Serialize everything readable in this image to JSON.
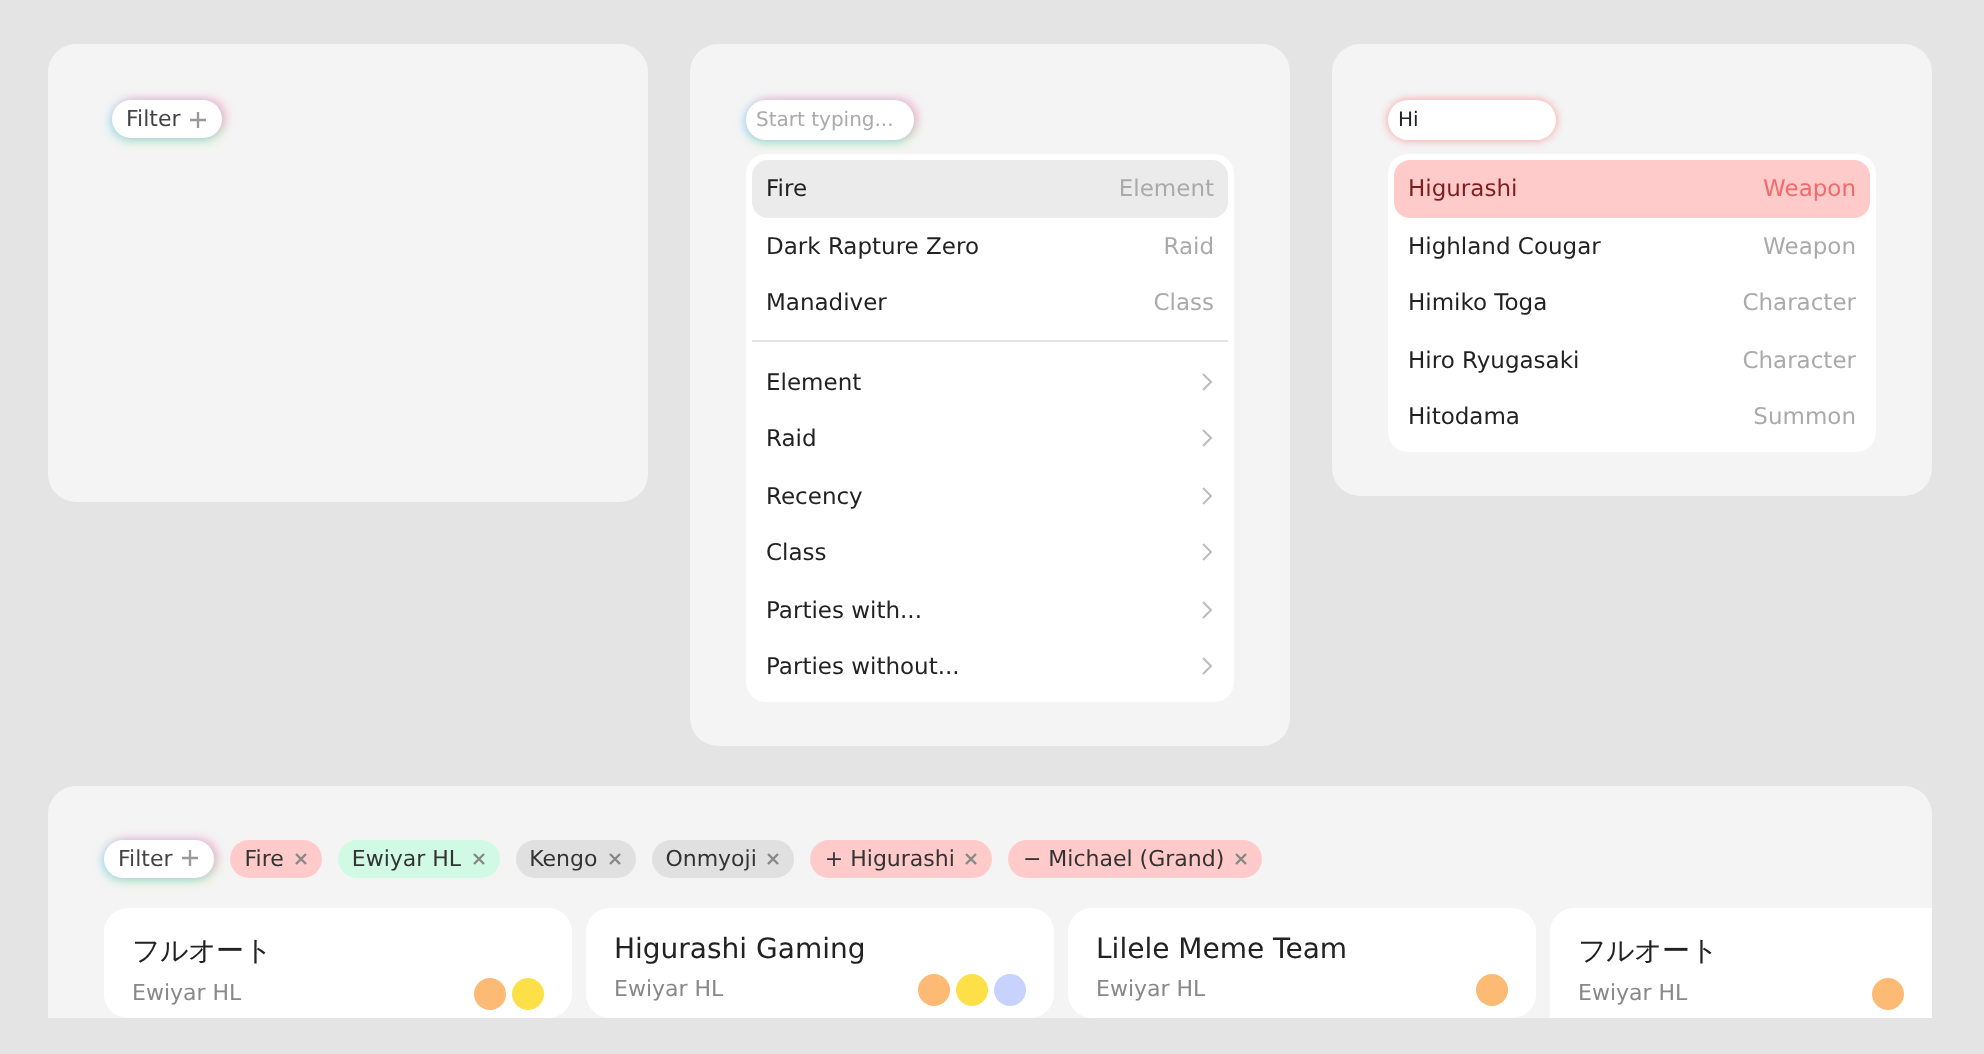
{
  "panels": [
    {
      "kind": "idle",
      "filter_button": {
        "label": "Filter"
      }
    },
    {
      "kind": "default",
      "search": {
        "placeholder": "Start typing..."
      },
      "suggestions": [
        {
          "label": "Fire",
          "category": "Element",
          "selected": true
        },
        {
          "label": "Dark Rapture Zero",
          "category": "Raid",
          "selected": false
        },
        {
          "label": "Manadiver",
          "category": "Class",
          "selected": false
        }
      ],
      "categories": [
        {
          "label": "Element"
        },
        {
          "label": "Raid"
        },
        {
          "label": "Recency"
        },
        {
          "label": "Class"
        },
        {
          "label": "Parties with..."
        },
        {
          "label": "Parties without..."
        }
      ]
    },
    {
      "kind": "include",
      "search": {
        "value": "Hi"
      },
      "suggestions": [
        {
          "label": "Higurashi",
          "category": "Weapon",
          "selected": true
        },
        {
          "label": "Highland Cougar",
          "category": "Weapon",
          "selected": false
        },
        {
          "label": "Himiko Toga",
          "category": "Character",
          "selected": false
        },
        {
          "label": "Hiro Ryugasaki",
          "category": "Character",
          "selected": false
        },
        {
          "label": "Hitodama",
          "category": "Summon",
          "selected": false
        }
      ]
    }
  ],
  "results": {
    "filter_button": {
      "label": "Filter"
    },
    "chips": [
      {
        "label": "Fire",
        "color": "#fecaca"
      },
      {
        "label": "Ewiyar HL",
        "color": "#d1fae5"
      },
      {
        "label": "Kengo",
        "color": "#e0e0e0"
      },
      {
        "label": "Onmyoji",
        "color": "#e0e0e0"
      },
      {
        "label": "Higurashi",
        "prefix": "+",
        "color": "#fecaca"
      },
      {
        "label": "Michael (Grand)",
        "prefix": "−",
        "color": "#fecaca"
      }
    ],
    "cards": [
      {
        "title": "フルオート",
        "subtitle": "Ewiyar HL",
        "badges": [
          {
            "color": "#fdba74"
          },
          {
            "color": "#fde047"
          }
        ]
      },
      {
        "title": "Higurashi Gaming",
        "subtitle": "Ewiyar HL",
        "badges": [
          {
            "color": "#fdba74"
          },
          {
            "color": "#fde047"
          },
          {
            "color": "#c7d2fe"
          }
        ]
      },
      {
        "title": "Lilele Meme Team",
        "subtitle": "Ewiyar HL",
        "badges": [
          {
            "color": "#fdba74"
          }
        ]
      },
      {
        "title": "フルオート",
        "subtitle": "Ewiyar HL",
        "badges": [
          {
            "color": "#fdba74"
          }
        ]
      }
    ]
  }
}
